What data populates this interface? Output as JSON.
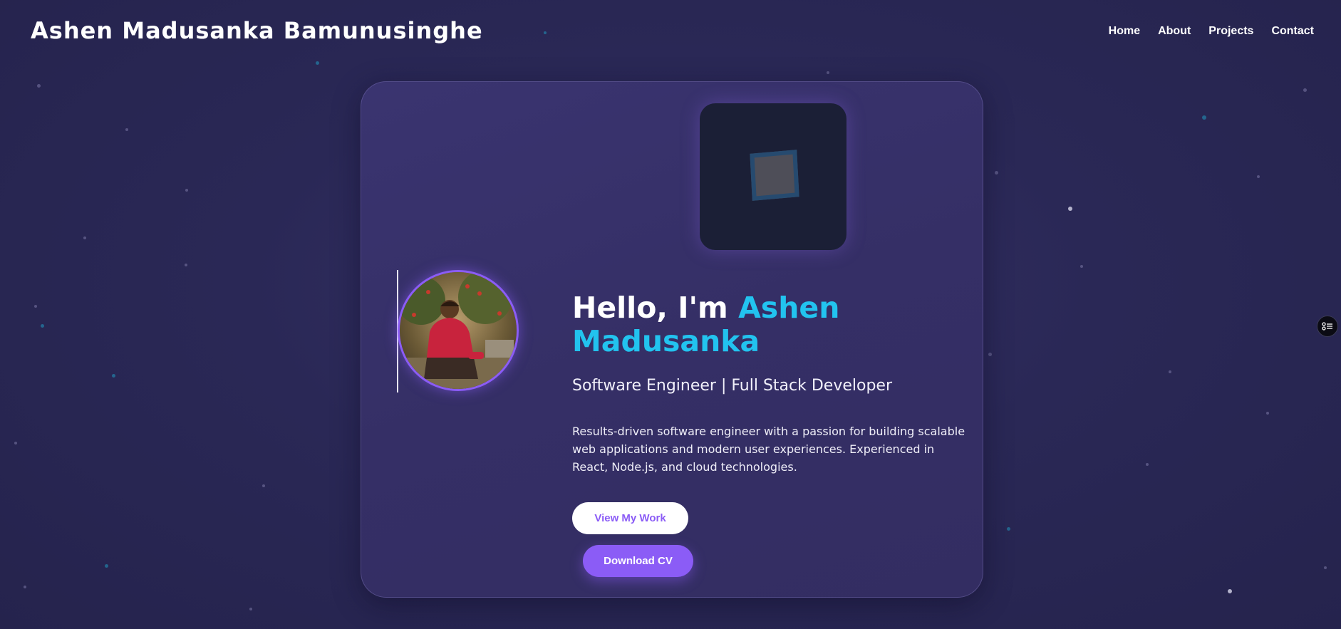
{
  "header": {
    "site_title": "Ashen Madusanka Bamunusinghe",
    "nav": [
      {
        "label": "Home"
      },
      {
        "label": "About"
      },
      {
        "label": "Projects"
      },
      {
        "label": "Contact"
      }
    ]
  },
  "hero": {
    "greeting_prefix": "Hello, I'm ",
    "greeting_name": "Ashen Madusanka",
    "role": "Software Engineer | Full Stack Developer",
    "bio": "Results-driven software engineer with a passion for building scalable web applications and modern user experiences. Experienced in React, Node.js, and cloud technologies.",
    "primary_button": "View My Work",
    "secondary_button": "Download CV"
  },
  "icons": {
    "side_widget": "accessibility-settings-icon",
    "showcase": "cube-icon",
    "avatar": "profile-photo"
  },
  "colors": {
    "background": "#2a2856",
    "card": "#372f69",
    "accent_purple": "#8b5cf6",
    "accent_cyan": "#22c3ef",
    "text": "#ffffff"
  }
}
